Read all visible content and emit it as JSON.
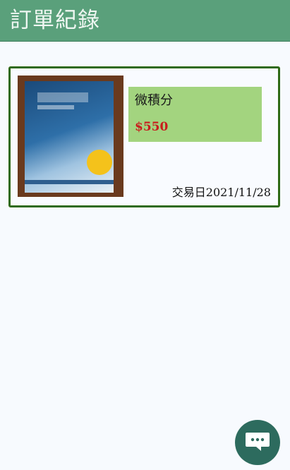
{
  "header": {
    "title": "訂單紀錄"
  },
  "orders": [
    {
      "product_name": "微積分",
      "price": "$550",
      "trade_date": "交易日2021/11/28"
    }
  ],
  "colors": {
    "header_bg": "#5aa07b",
    "card_border": "#2f6a16",
    "info_bg": "#a3d47f",
    "price": "#c81d1d",
    "chat_button": "#2d6b5e"
  },
  "icons": {
    "chat": "chat-bubble-icon"
  }
}
